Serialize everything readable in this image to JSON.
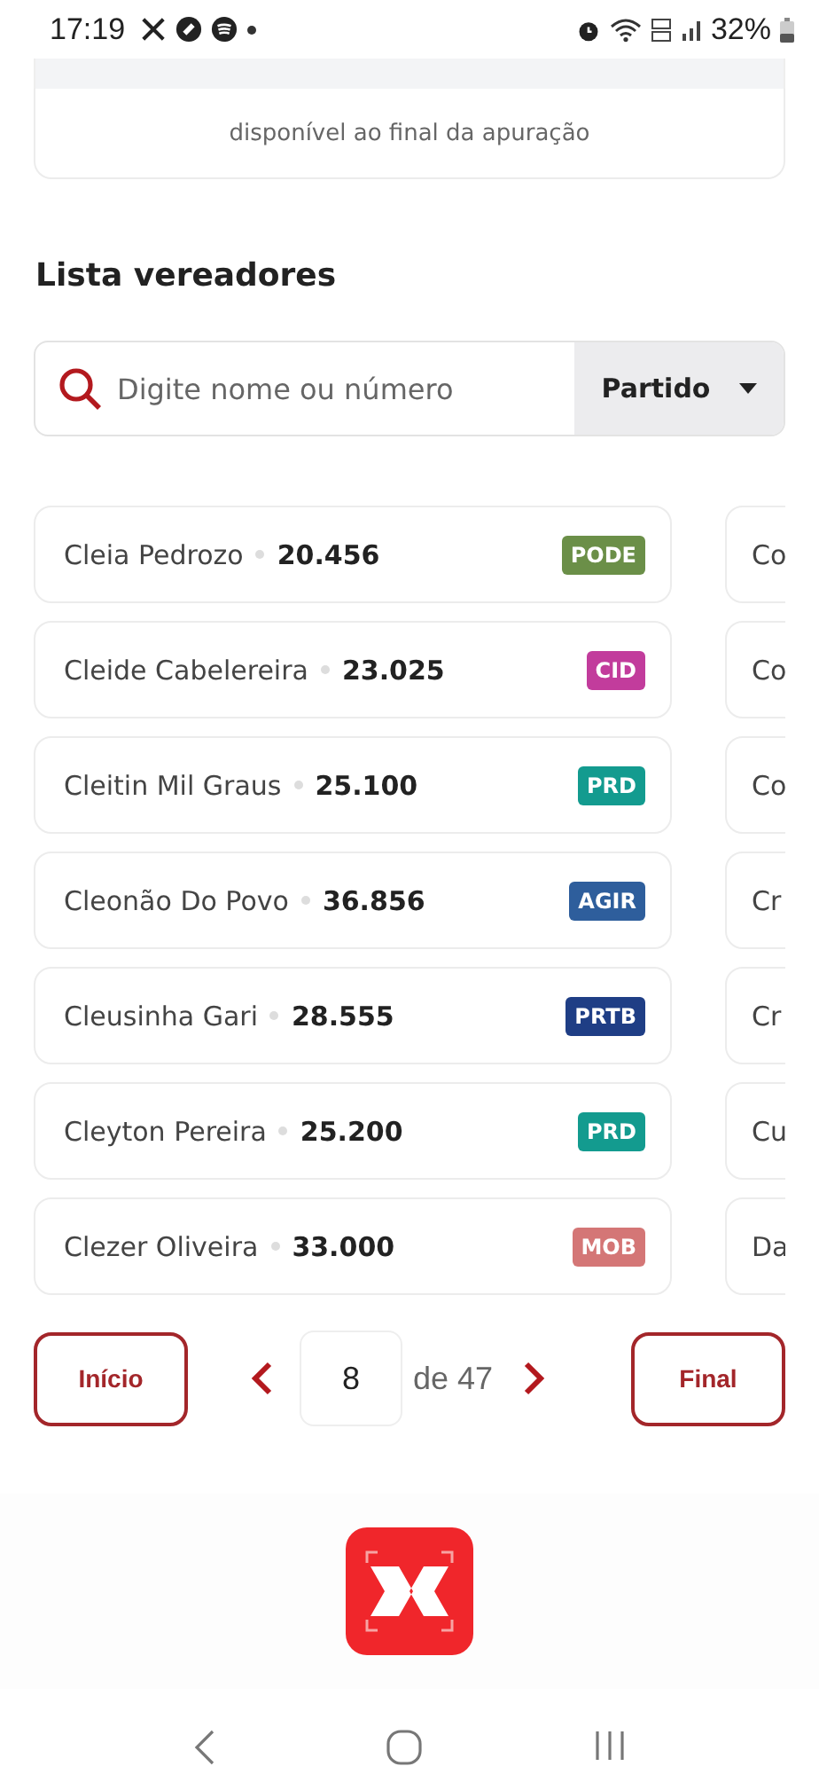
{
  "status_bar": {
    "time": "17:19",
    "battery": "32%"
  },
  "notice": {
    "text": "disponível ao final da apuração"
  },
  "section_title": "Lista vereadores",
  "search": {
    "placeholder": "Digite nome ou número",
    "filter": "Partido"
  },
  "candidates": [
    {
      "name": "Cleia Pedrozo",
      "votes": "20.456",
      "party": "PODE",
      "color": "#6b8f48"
    },
    {
      "name": "Cleide Cabelereira",
      "votes": "23.025",
      "party": "CID",
      "color": "#c23c9c"
    },
    {
      "name": "Cleitin Mil Graus",
      "votes": "25.100",
      "party": "PRD",
      "color": "#139b8f"
    },
    {
      "name": "Cleonão Do Povo",
      "votes": "36.856",
      "party": "AGIR",
      "color": "#2e5e9c"
    },
    {
      "name": "Cleusinha Gari",
      "votes": "28.555",
      "party": "PRTB",
      "color": "#1f3e85"
    },
    {
      "name": "Cleyton Pereira",
      "votes": "25.200",
      "party": "PRD",
      "color": "#139b8f"
    },
    {
      "name": "Clezer Oliveira",
      "votes": "33.000",
      "party": "MOB",
      "color": "#d47676"
    }
  ],
  "next_column": [
    "Co",
    "Co",
    "Co",
    "Cr",
    "Cr",
    "Cu",
    "Da"
  ],
  "pagination": {
    "first": "Início",
    "page": "8",
    "total": "de 47",
    "last": "Final"
  }
}
